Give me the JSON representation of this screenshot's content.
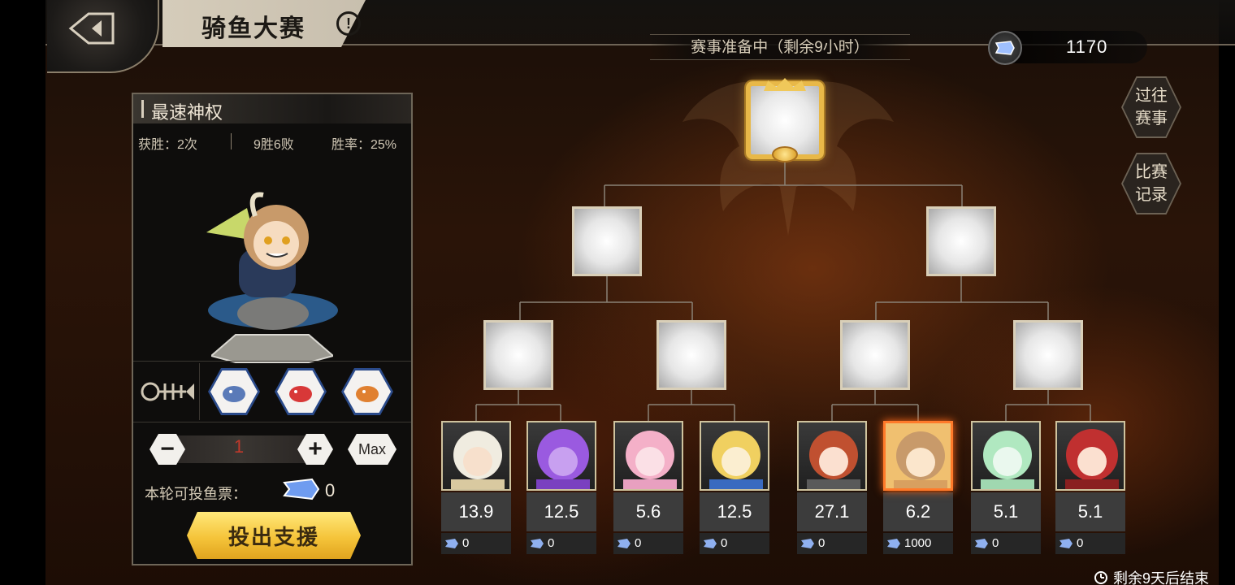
{
  "header": {
    "title": "骑鱼大赛",
    "info_glyph": "!",
    "status": "赛事准备中（剩余9小时）",
    "currency_value": "1170",
    "past_events_label": "过往\n赛事",
    "records_label": "比赛\n记录"
  },
  "panel": {
    "name": "最速神权",
    "wins": "获胜：2次",
    "record": "9胜6败",
    "win_rate": "胜率：25%",
    "bet_amount": "1",
    "max_label": "Max",
    "ticket_label": "本轮可投鱼票：",
    "ticket_count": "0",
    "support_label": "投出支援"
  },
  "players": [
    {
      "odds": "13.9",
      "bets": "0",
      "theme": "#d9c9a0",
      "hair": "#f0ece0"
    },
    {
      "odds": "12.5",
      "bets": "0",
      "theme": "#7a40c0",
      "hair": "#9a5ae0"
    },
    {
      "odds": "5.6",
      "bets": "0",
      "theme": "#e8a0c0",
      "hair": "#f4b0c8"
    },
    {
      "odds": "12.5",
      "bets": "0",
      "theme": "#3a6ac0",
      "hair": "#f0d060"
    },
    {
      "odds": "27.1",
      "bets": "0",
      "theme": "#5a5a5a",
      "hair": "#c05030"
    },
    {
      "odds": "6.2",
      "bets": "1000",
      "theme": "#d8a060",
      "hair": "#c89a6a"
    },
    {
      "odds": "5.1",
      "bets": "0",
      "theme": "#a0d8b0",
      "hair": "#b0e8c0"
    },
    {
      "odds": "5.1",
      "bets": "0",
      "theme": "#c03030",
      "hair": "#e05030"
    }
  ],
  "footer": {
    "time_left": "剩余9天后结束"
  },
  "colors": {
    "accent_gold": "#f5c43a",
    "selected_border": "#ff7a2a"
  }
}
